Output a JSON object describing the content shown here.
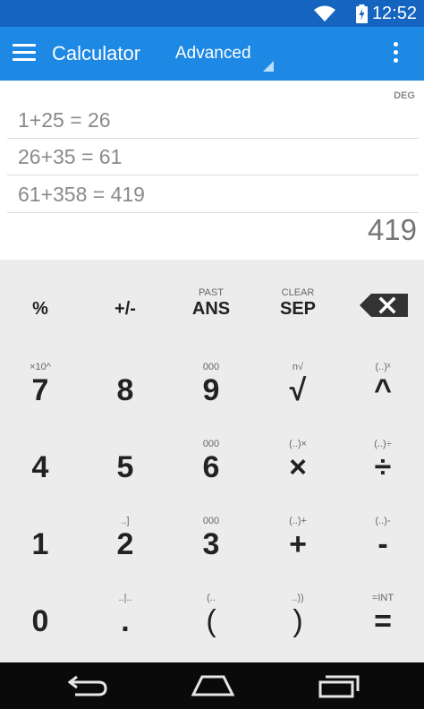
{
  "status": {
    "time": "12:52"
  },
  "appbar": {
    "title": "Calculator",
    "mode": "Advanced"
  },
  "display": {
    "angle_mode": "DEG",
    "history": [
      "1+25 = 26",
      "26+35 = 61",
      "61+358 = 419"
    ],
    "result": "419"
  },
  "keypad": {
    "row1": [
      {
        "sub": "",
        "label": "%"
      },
      {
        "sub": "",
        "label": "+/-"
      },
      {
        "sub": "PAST",
        "label": "ANS"
      },
      {
        "sub": "CLEAR",
        "label": "SEP"
      }
    ],
    "row2": [
      {
        "sub": "×10^",
        "label": "7"
      },
      {
        "sub": "",
        "label": "8"
      },
      {
        "sub": "000",
        "label": "9"
      },
      {
        "sub": "n√",
        "label": "√"
      },
      {
        "sub": "(..)ˣ",
        "label": "^"
      }
    ],
    "row3": [
      {
        "sub": "",
        "label": "4"
      },
      {
        "sub": "",
        "label": "5"
      },
      {
        "sub": "000",
        "label": "6"
      },
      {
        "sub": "(..)×",
        "label": "×"
      },
      {
        "sub": "(..)÷",
        "label": "÷"
      }
    ],
    "row4": [
      {
        "sub": "",
        "label": "1"
      },
      {
        "sub": "..]",
        "label": "2"
      },
      {
        "sub": "000",
        "label": "3"
      },
      {
        "sub": "(..)+",
        "label": "+"
      },
      {
        "sub": "(..)-",
        "label": "-"
      }
    ],
    "row5": [
      {
        "sub": "",
        "label": "0"
      },
      {
        "sub": "..|..",
        "label": "."
      },
      {
        "sub": "(..",
        "label": "("
      },
      {
        "sub": "..))",
        "label": ")"
      },
      {
        "sub": "=INT",
        "label": "="
      }
    ]
  },
  "icons": {
    "backspace": "backspace-icon",
    "menu": "menu-icon",
    "more": "more-vert-icon"
  },
  "colors": {
    "statusbar": "#1565c0",
    "appbar": "#1e88e5",
    "keypad_bg": "#ececec",
    "navbar": "#0a0a0a"
  }
}
